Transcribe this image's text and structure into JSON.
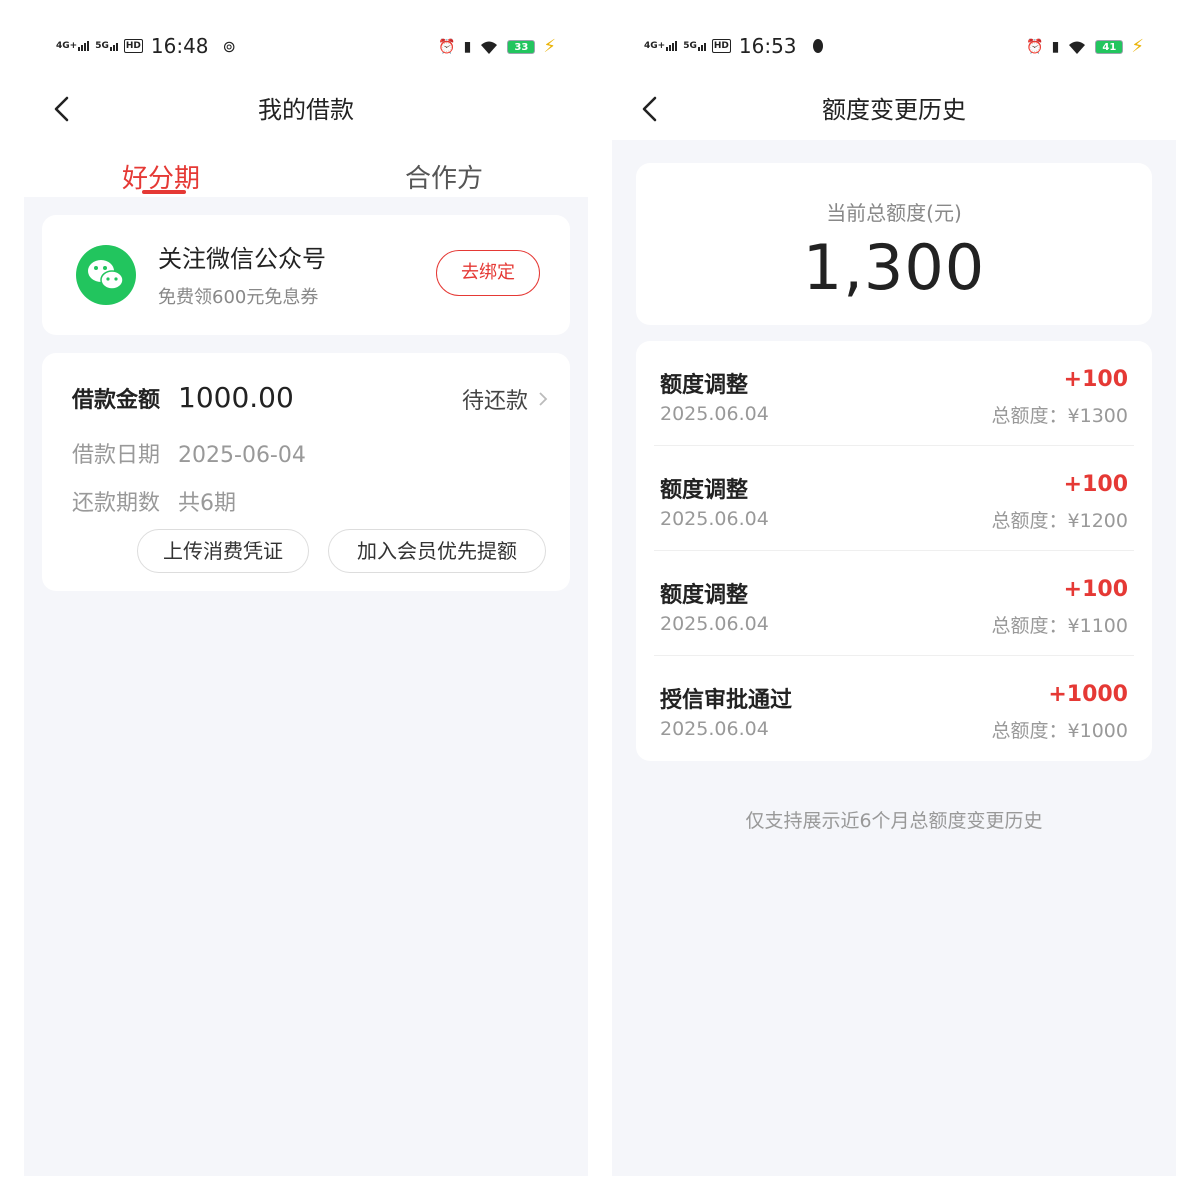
{
  "colors": {
    "accent": "#e53935",
    "wechat": "#22c55e",
    "battery": "#22c55e"
  },
  "left": {
    "status": {
      "net1": "4G+",
      "net2": "5G",
      "hd": "HD",
      "time": "16:48",
      "battery": "33"
    },
    "nav": {
      "title": "我的借款"
    },
    "tabs": [
      {
        "label": "好分期",
        "active": true
      },
      {
        "label": "合作方",
        "active": false
      }
    ],
    "wechat_card": {
      "icon": "wechat-icon",
      "title": "关注微信公众号",
      "subtitle": "免费领600元免息券",
      "button": "去绑定"
    },
    "loan_card": {
      "amount_label": "借款金额",
      "amount_value": "1000.00",
      "status": "待还款",
      "date_label": "借款日期",
      "date_value": "2025-06-04",
      "periods_label": "还款期数",
      "periods_value": "共6期",
      "upload_button": "上传消费凭证",
      "member_button": "加入会员优先提额"
    }
  },
  "right": {
    "status": {
      "net1": "4G+",
      "net2": "5G",
      "hd": "HD",
      "time": "16:53",
      "battery": "41"
    },
    "nav": {
      "title": "额度变更历史"
    },
    "total": {
      "label": "当前总额度(元)",
      "value": "1,300"
    },
    "history": [
      {
        "title": "额度调整",
        "date": "2025.06.04",
        "delta": "+100",
        "total": "总额度：¥1300"
      },
      {
        "title": "额度调整",
        "date": "2025.06.04",
        "delta": "+100",
        "total": "总额度：¥1200"
      },
      {
        "title": "额度调整",
        "date": "2025.06.04",
        "delta": "+100",
        "total": "总额度：¥1100"
      },
      {
        "title": "授信审批通过",
        "date": "2025.06.04",
        "delta": "+1000",
        "total": "总额度：¥1000"
      }
    ],
    "footer": "仅支持展示近6个月总额度变更历史"
  }
}
